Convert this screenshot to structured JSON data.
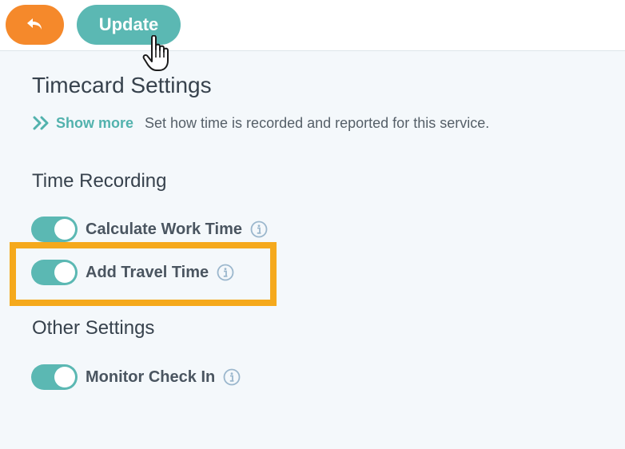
{
  "toolbar": {
    "back_icon": "undo-arrow-icon",
    "update_label": "Update"
  },
  "header": {
    "title": "Timecard Settings",
    "show_more_label": "Show more",
    "description": "Set how time is recorded and reported for this service."
  },
  "sections": [
    {
      "title": "Time Recording",
      "settings": [
        {
          "label": "Calculate Work Time",
          "enabled": true
        },
        {
          "label": "Add Travel Time",
          "enabled": true,
          "highlighted": true
        }
      ]
    },
    {
      "title": "Other Settings",
      "settings": [
        {
          "label": "Monitor Check In",
          "enabled": true
        }
      ]
    }
  ],
  "colors": {
    "accent": "#5bb8b3",
    "back_button": "#f5892b",
    "highlight": "#f5a91c",
    "background": "#f4f8fb"
  },
  "icons": {
    "show_more": "double-chevron-right-icon",
    "info": "info-circle-icon",
    "cursor": "hand-pointer-cursor-icon"
  }
}
